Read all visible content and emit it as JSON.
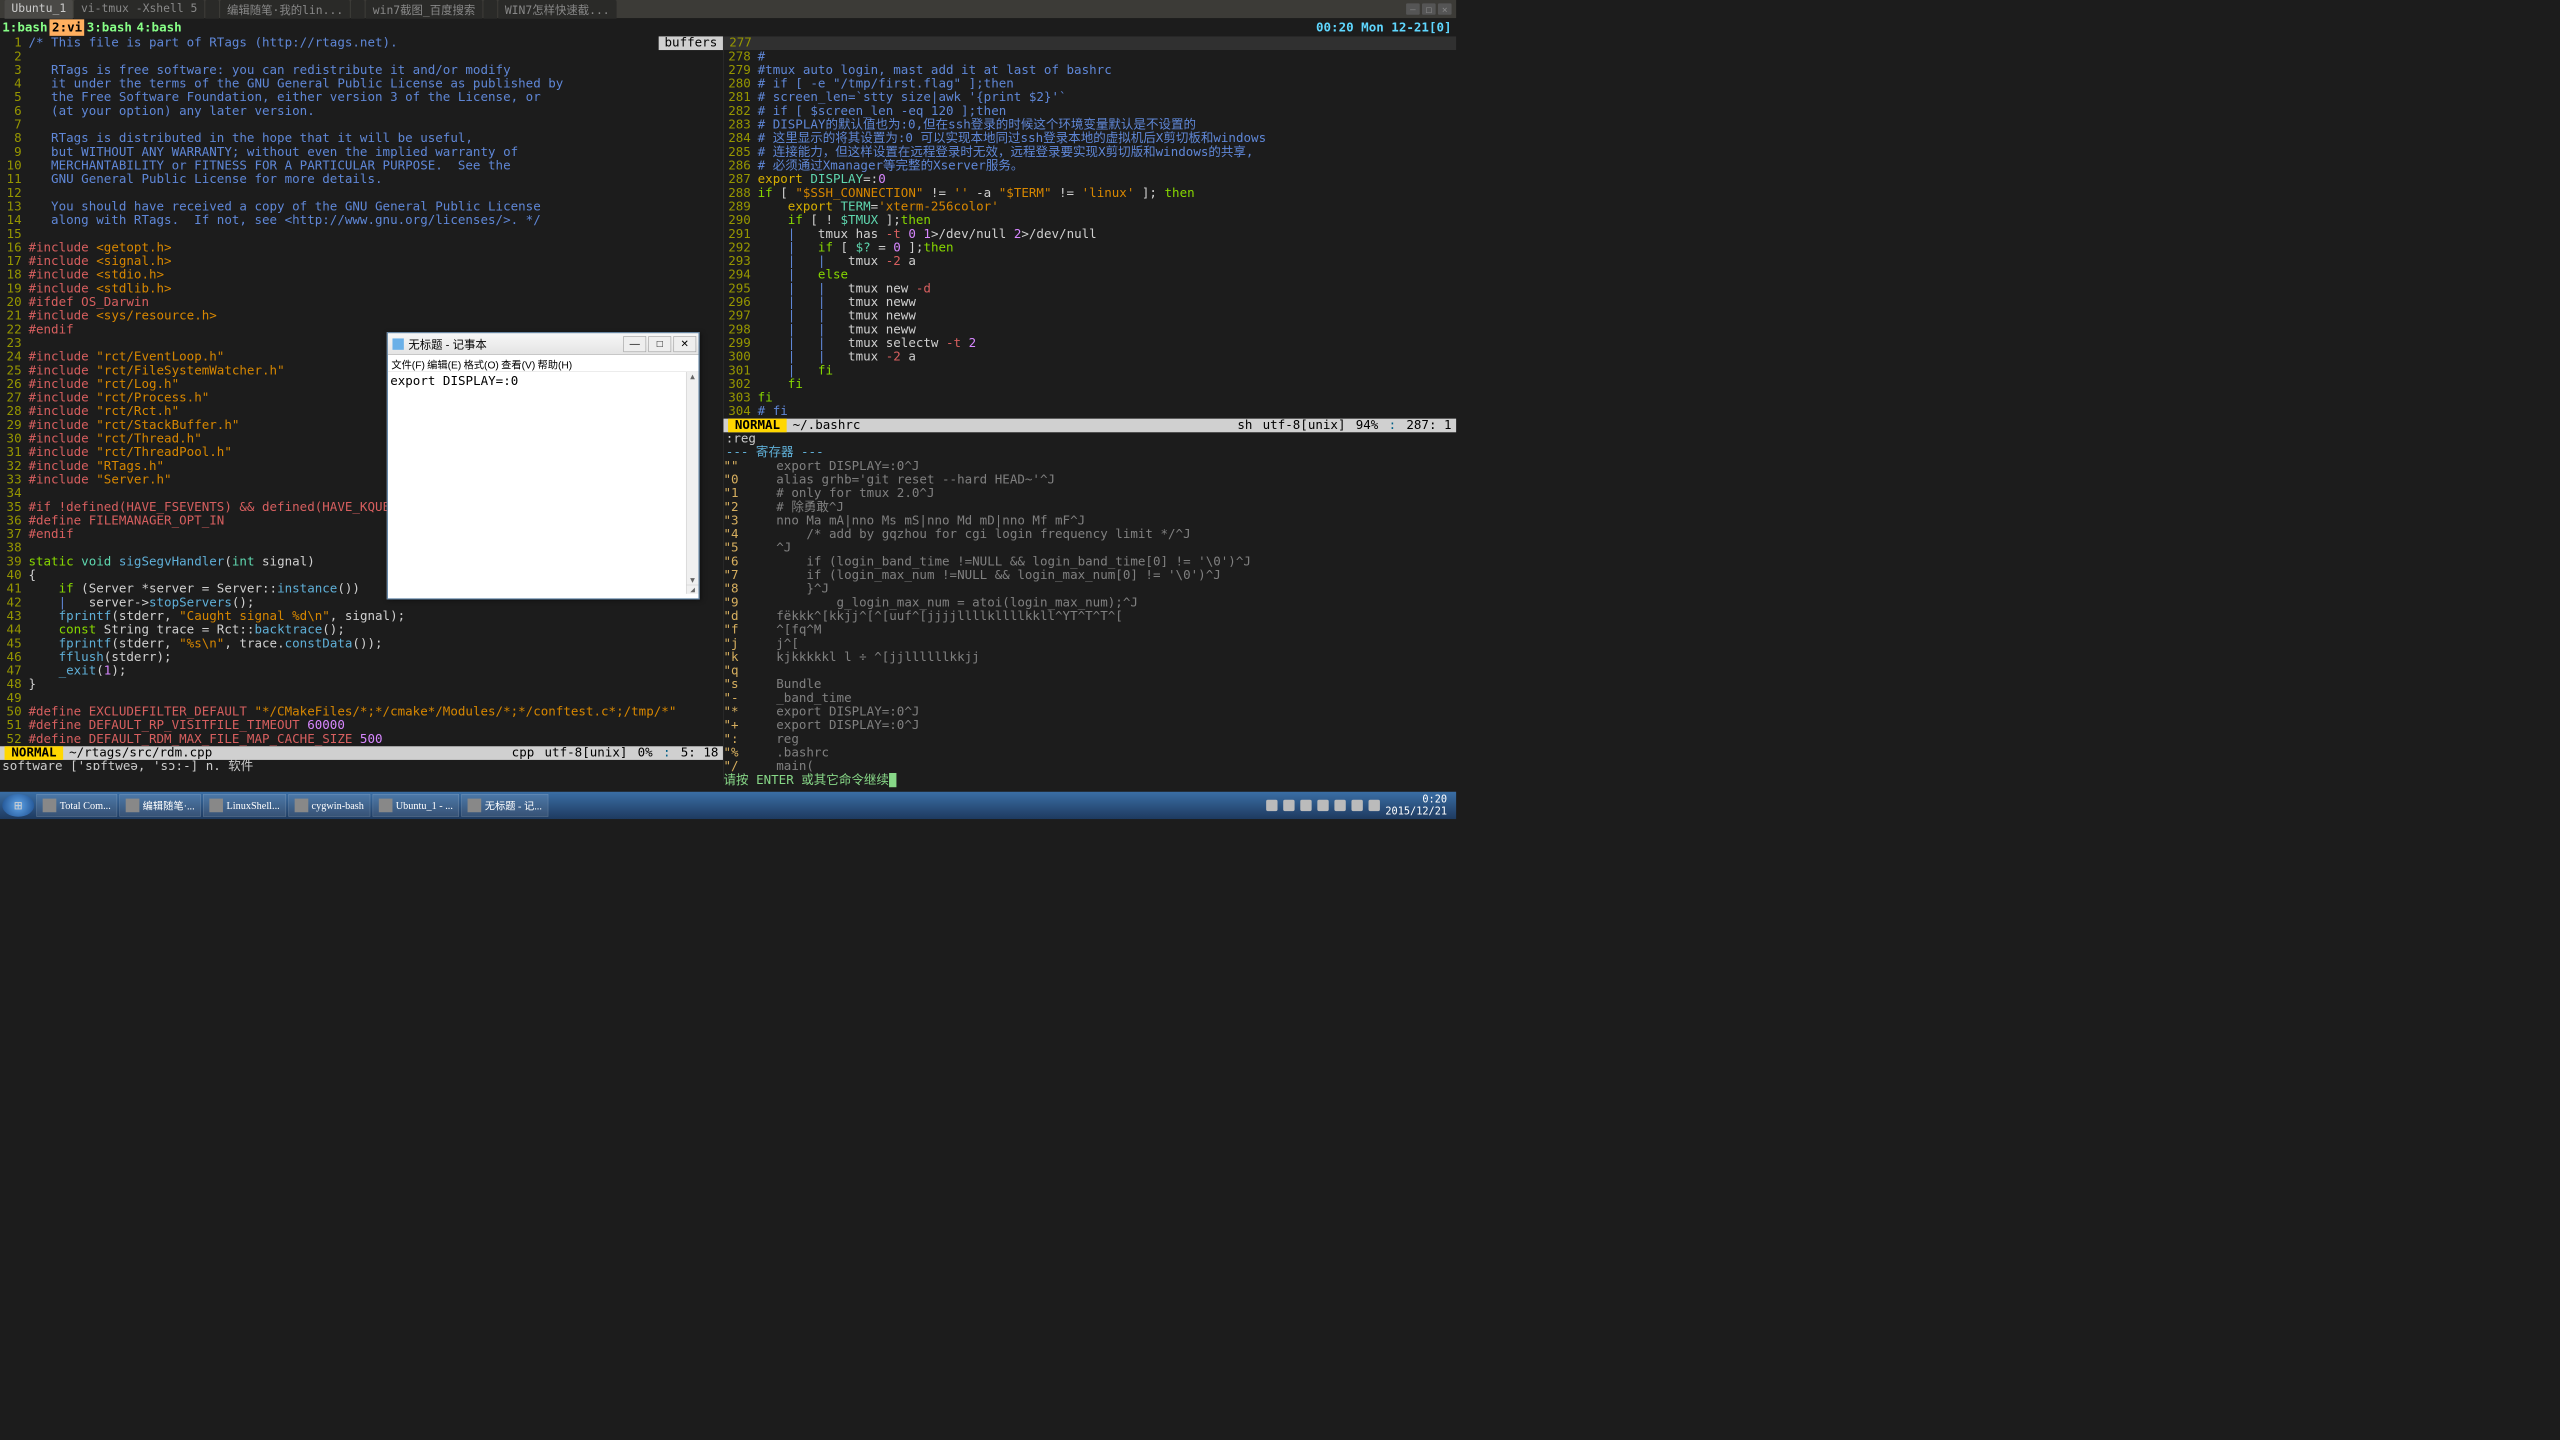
{
  "titlebar": {
    "tabs": [
      "Ubuntu_1",
      "vi-tmux  -Xshell 5",
      "",
      "编辑随笔·我的lin...",
      "",
      "win7截图_百度搜索",
      "",
      "WIN7怎样快速截..."
    ],
    "active": 0
  },
  "wincontrols": [
    "—",
    "□",
    "✕"
  ],
  "tmux": {
    "tabs": [
      "1:bash",
      "2:vi",
      "3:bash",
      "4:bash"
    ],
    "active": 1,
    "clock": "00:20 Mon 12-21[0]"
  },
  "leftpane": {
    "buf_label": "buffers",
    "lines": [
      {
        "n": 1,
        "t": "/* This file is part of RTags (http://rtags.net).",
        "cls": "c"
      },
      {
        "n": 2,
        "t": "",
        "cls": "c"
      },
      {
        "n": 3,
        "t": "   RTags is free software: you can redistribute it and/or modify",
        "cls": "c"
      },
      {
        "n": 4,
        "t": "   it under the terms of the GNU General Public License as published by",
        "cls": "c"
      },
      {
        "n": 5,
        "t": "   the Free Software Foundation, either version 3 of the License, or",
        "cls": "c"
      },
      {
        "n": 6,
        "t": "   (at your option) any later version.",
        "cls": "c"
      },
      {
        "n": 7,
        "t": "",
        "cls": "c"
      },
      {
        "n": 8,
        "t": "   RTags is distributed in the hope that it will be useful,",
        "cls": "c"
      },
      {
        "n": 9,
        "t": "   but WITHOUT ANY WARRANTY; without even the implied warranty of",
        "cls": "c"
      },
      {
        "n": 10,
        "t": "   MERCHANTABILITY or FITNESS FOR A PARTICULAR PURPOSE.  See the",
        "cls": "c"
      },
      {
        "n": 11,
        "t": "   GNU General Public License for more details.",
        "cls": "c"
      },
      {
        "n": 12,
        "t": "",
        "cls": "c"
      },
      {
        "n": 13,
        "t": "   You should have received a copy of the GNU General Public License",
        "cls": "c"
      },
      {
        "n": 14,
        "t": "   along with RTags.  If not, see <http://www.gnu.org/licenses/>. */",
        "cls": "c"
      },
      {
        "n": 15,
        "t": ""
      },
      {
        "n": 16,
        "html": "<span class='pp'>#include</span> <span class='str'>&lt;getopt.h&gt;</span>"
      },
      {
        "n": 17,
        "html": "<span class='pp'>#include</span> <span class='str'>&lt;signal.h&gt;</span>"
      },
      {
        "n": 18,
        "html": "<span class='pp'>#include</span> <span class='str'>&lt;stdio.h&gt;</span>"
      },
      {
        "n": 19,
        "html": "<span class='pp'>#include</span> <span class='str'>&lt;stdlib.h&gt;</span>"
      },
      {
        "n": 20,
        "html": "<span class='pp'>#ifdef OS_Darwin</span>"
      },
      {
        "n": 21,
        "html": "<span class='pp'>#include</span> <span class='str'>&lt;sys/resource.h&gt;</span>"
      },
      {
        "n": 22,
        "html": "<span class='pp'>#endif</span>"
      },
      {
        "n": 23,
        "t": ""
      },
      {
        "n": 24,
        "html": "<span class='pp'>#include</span> <span class='str'>\"rct/EventLoop.h\"</span>"
      },
      {
        "n": 25,
        "html": "<span class='pp'>#include</span> <span class='str'>\"rct/FileSystemWatcher.h\"</span>"
      },
      {
        "n": 26,
        "html": "<span class='pp'>#include</span> <span class='str'>\"rct/Log.h\"</span>"
      },
      {
        "n": 27,
        "html": "<span class='pp'>#include</span> <span class='str'>\"rct/Process.h\"</span>"
      },
      {
        "n": 28,
        "html": "<span class='pp'>#include</span> <span class='str'>\"rct/Rct.h\"</span>"
      },
      {
        "n": 29,
        "html": "<span class='pp'>#include</span> <span class='str'>\"rct/StackBuffer.h\"</span>"
      },
      {
        "n": 30,
        "html": "<span class='pp'>#include</span> <span class='str'>\"rct/Thread.h\"</span>"
      },
      {
        "n": 31,
        "html": "<span class='pp'>#include</span> <span class='str'>\"rct/ThreadPool.h\"</span>"
      },
      {
        "n": 32,
        "html": "<span class='pp'>#include</span> <span class='str'>\"RTags.h\"</span>"
      },
      {
        "n": 33,
        "html": "<span class='pp'>#include</span> <span class='str'>\"Server.h\"</span>"
      },
      {
        "n": 34,
        "t": ""
      },
      {
        "n": 35,
        "html": "<span class='pp'>#if !defined(HAVE_FSEVENTS) && defined(HAVE_KQUEUE)</span>"
      },
      {
        "n": 36,
        "html": "<span class='pp'>#define FILEMANAGER_OPT_IN</span>"
      },
      {
        "n": 37,
        "html": "<span class='pp'>#endif</span>"
      },
      {
        "n": 38,
        "t": ""
      },
      {
        "n": 39,
        "html": "<span class='kw'>static</span> <span class='ty'>void</span> <span class='fn'>sigSegvHandler</span>(<span class='ty'>int</span> signal)"
      },
      {
        "n": 40,
        "t": "{"
      },
      {
        "n": 41,
        "html": "    <span class='kw'>if</span> (Server *server = Server::<span class='fn'>instance</span>())"
      },
      {
        "n": 42,
        "html": "    <span class='c'>|</span>   server-><span class='fn'>stopServers</span>();"
      },
      {
        "n": 43,
        "html": "    <span class='fn'>fprintf</span>(stderr, <span class='str'>\"Caught signal %d\\n\"</span>, signal);"
      },
      {
        "n": 44,
        "html": "    <span class='kw'>const</span> String trace = Rct::<span class='fn'>backtrace</span>();"
      },
      {
        "n": 45,
        "html": "    <span class='fn'>fprintf</span>(stderr, <span class='str'>\"%s\\n\"</span>, trace.<span class='fn'>constData</span>());"
      },
      {
        "n": 46,
        "html": "    <span class='fn'>fflush</span>(stderr);"
      },
      {
        "n": 47,
        "html": "    <span class='fn'>_exit</span>(<span class='num'>1</span>);"
      },
      {
        "n": 48,
        "t": "}"
      },
      {
        "n": 49,
        "t": ""
      },
      {
        "n": 50,
        "html": "<span class='pp'>#define EXCLUDEFILTER_DEFAULT</span> <span class='str'>\"*/CMakeFiles/*;*/cmake*/Modules/*;*/conftest.c*;/tmp/*\"</span>"
      },
      {
        "n": 51,
        "html": "<span class='pp'>#define DEFAULT_RP_VISITFILE_TIMEOUT</span> <span class='num'>60000</span>"
      },
      {
        "n": 52,
        "html": "<span class='pp'>#define DEFAULT_RDM_MAX_FILE_MAP_CACHE_SIZE</span> <span class='num'>500</span>"
      }
    ],
    "status": {
      "mode": "NORMAL",
      "file": "~/rtags/src/rdm.cpp",
      "ft": "cpp",
      "enc": "utf-8[unix]",
      "pct": "0%",
      "pos": "5:  18"
    },
    "cmd": "software ['sɒftweə, 'sɔ:-] n. 软件"
  },
  "rightpane": {
    "top_num": "277",
    "lines": [
      {
        "n": 278,
        "html": "<span class='c'>#</span>"
      },
      {
        "n": 279,
        "html": "<span class='c'>#tmux auto login, mast add it at last of bashrc</span>"
      },
      {
        "n": 280,
        "html": "<span class='c'># if [ -e \"/tmp/first.flag\" ];then</span>"
      },
      {
        "n": 281,
        "html": "<span class='c'># screen_len=`stty size|awk '{print $2}'`</span>"
      },
      {
        "n": 282,
        "html": "<span class='c'># if [ $screen_len -eq 120 ];then</span>"
      },
      {
        "n": 283,
        "html": "<span class='c'># DISPLAY的默认值也为:0,但在ssh登录的时候这个环境变量默认是不设置的</span>"
      },
      {
        "n": 284,
        "html": "<span class='c'># 这里显示的将其设置为:0 可以实现本地同过ssh登录本地的虚拟机后X剪切板和windows</span>"
      },
      {
        "n": 285,
        "html": "<span class='c'># 连接能力，但这样设置在远程登录时无效，远程登录要实现X剪切版和windows的共享,</span>"
      },
      {
        "n": 286,
        "html": "<span class='c'># 必须通过Xmanager等完整的Xserver服务。</span>"
      },
      {
        "n": 287,
        "html": "<span class='cmd-y'>export</span> <span class='ty'>DISPLAY</span>=:<span class='num'>0</span>"
      },
      {
        "n": 288,
        "html": "<span class='kw'>if</span> [ <span class='str'>\"$SSH_CONNECTION\"</span> != <span class='str'>''</span> -a <span class='str'>\"$TERM\"</span> != <span class='str'>'linux'</span> ]; <span class='kw'>then</span>"
      },
      {
        "n": 289,
        "html": "    <span class='cmd-y'>export</span> <span class='ty'>TERM</span>=<span class='str'>'xterm-256color'</span>"
      },
      {
        "n": 290,
        "html": "    <span class='kw'>if</span> [ ! <span class='ty'>$TMUX</span> ];<span class='kw'>then</span>"
      },
      {
        "n": 291,
        "html": "    <span class='c'>|</span>   tmux has <span class='pp'>-t</span> <span class='num'>0</span> <span class='num'>1</span>&gt;/dev/null <span class='num'>2</span>&gt;/dev/null"
      },
      {
        "n": 292,
        "html": "    <span class='c'>|</span>   <span class='kw'>if</span> [ <span class='ty'>$?</span> = <span class='num'>0</span> ];<span class='kw'>then</span>"
      },
      {
        "n": 293,
        "html": "    <span class='c'>|   |</span>   tmux <span class='pp'>-2</span> a"
      },
      {
        "n": 294,
        "html": "    <span class='c'>|</span>   <span class='kw'>else</span>"
      },
      {
        "n": 295,
        "html": "    <span class='c'>|   |</span>   tmux new <span class='pp'>-d</span>"
      },
      {
        "n": 296,
        "html": "    <span class='c'>|   |</span>   tmux neww"
      },
      {
        "n": 297,
        "html": "    <span class='c'>|   |</span>   tmux neww"
      },
      {
        "n": 298,
        "html": "    <span class='c'>|   |</span>   tmux neww"
      },
      {
        "n": 299,
        "html": "    <span class='c'>|   |</span>   tmux selectw <span class='pp'>-t</span> <span class='num'>2</span>"
      },
      {
        "n": 300,
        "html": "    <span class='c'>|   |</span>   tmux <span class='pp'>-2</span> a"
      },
      {
        "n": 301,
        "html": "    <span class='c'>|</span>   <span class='kw'>fi</span>"
      },
      {
        "n": 302,
        "html": "    <span class='kw'>fi</span>"
      },
      {
        "n": 303,
        "html": "<span class='kw'>fi</span>"
      },
      {
        "n": 304,
        "html": "<span class='c'># fi</span>"
      }
    ],
    "status": {
      "mode": "NORMAL",
      "file": "~/.bashrc",
      "ft": "sh",
      "enc": "utf-8[unix]",
      "pct": "94%",
      "pos": "287:   1"
    },
    "reg_cmd": ":reg",
    "reg_hdr": "--- 寄存器 ---",
    "registers": [
      [
        "\"\"",
        "  export DISPLAY=:0^J"
      ],
      [
        "\"0",
        "  alias grhb='git reset --hard HEAD~'^J"
      ],
      [
        "\"1",
        "  # only for tmux 2.0^J"
      ],
      [
        "\"2",
        "  # 除勇敢^J"
      ],
      [
        "\"3",
        "  nno Ma mA|nno Ms mS|nno Md mD|nno Mf mF^J"
      ],
      [
        "\"4",
        "      /* add by gqzhou for cgi login frequency limit */^J"
      ],
      [
        "\"5",
        "  ^J"
      ],
      [
        "\"6",
        "      if (login_band_time !=NULL && login_band_time[0] != '\\0')^J"
      ],
      [
        "\"7",
        "      if (login_max_num !=NULL && login_max_num[0] != '\\0')^J"
      ],
      [
        "\"8",
        "      }^J"
      ],
      [
        "\"9",
        "          g_login_max_num = atoi(login_max_num);^J"
      ],
      [
        "\"d",
        "  fëkkk^[kkjj^[^[uuf^[jjjjllllkllllkkll^YT^T^T^["
      ],
      [
        "\"f",
        "  ^[fq^M"
      ],
      [
        "\"j",
        "  j^["
      ],
      [
        "\"k",
        "  kjkkkkkl l ÷ ^[jjllllllkkjj"
      ],
      [
        "\"q",
        ""
      ],
      [
        "\"s",
        "  Bundle"
      ],
      [
        "\"-",
        "  _band_time"
      ],
      [
        "\"*",
        "  export DISPLAY=:0^J"
      ],
      [
        "\"+",
        "  export DISPLAY=:0^J"
      ],
      [
        "\":",
        "  reg"
      ],
      [
        "\"%",
        "  .bashrc"
      ],
      [
        "\"/",
        "  main("
      ]
    ],
    "prompt": "请按 ENTER 或其它命令继续"
  },
  "notepad": {
    "title": "无标题 - 记事本",
    "menu": [
      "文件(F)",
      "编辑(E)",
      "格式(O)",
      "查看(V)",
      "帮助(H)"
    ],
    "content": "export DISPLAY=:0"
  },
  "taskbar": {
    "items": [
      "Total Com...",
      "编辑随笔·...",
      "LinuxShell...",
      "cygwin-bash",
      "Ubuntu_1 - ...",
      "无标题 - 记..."
    ],
    "time": "0:20",
    "date": "2015/12/21"
  }
}
